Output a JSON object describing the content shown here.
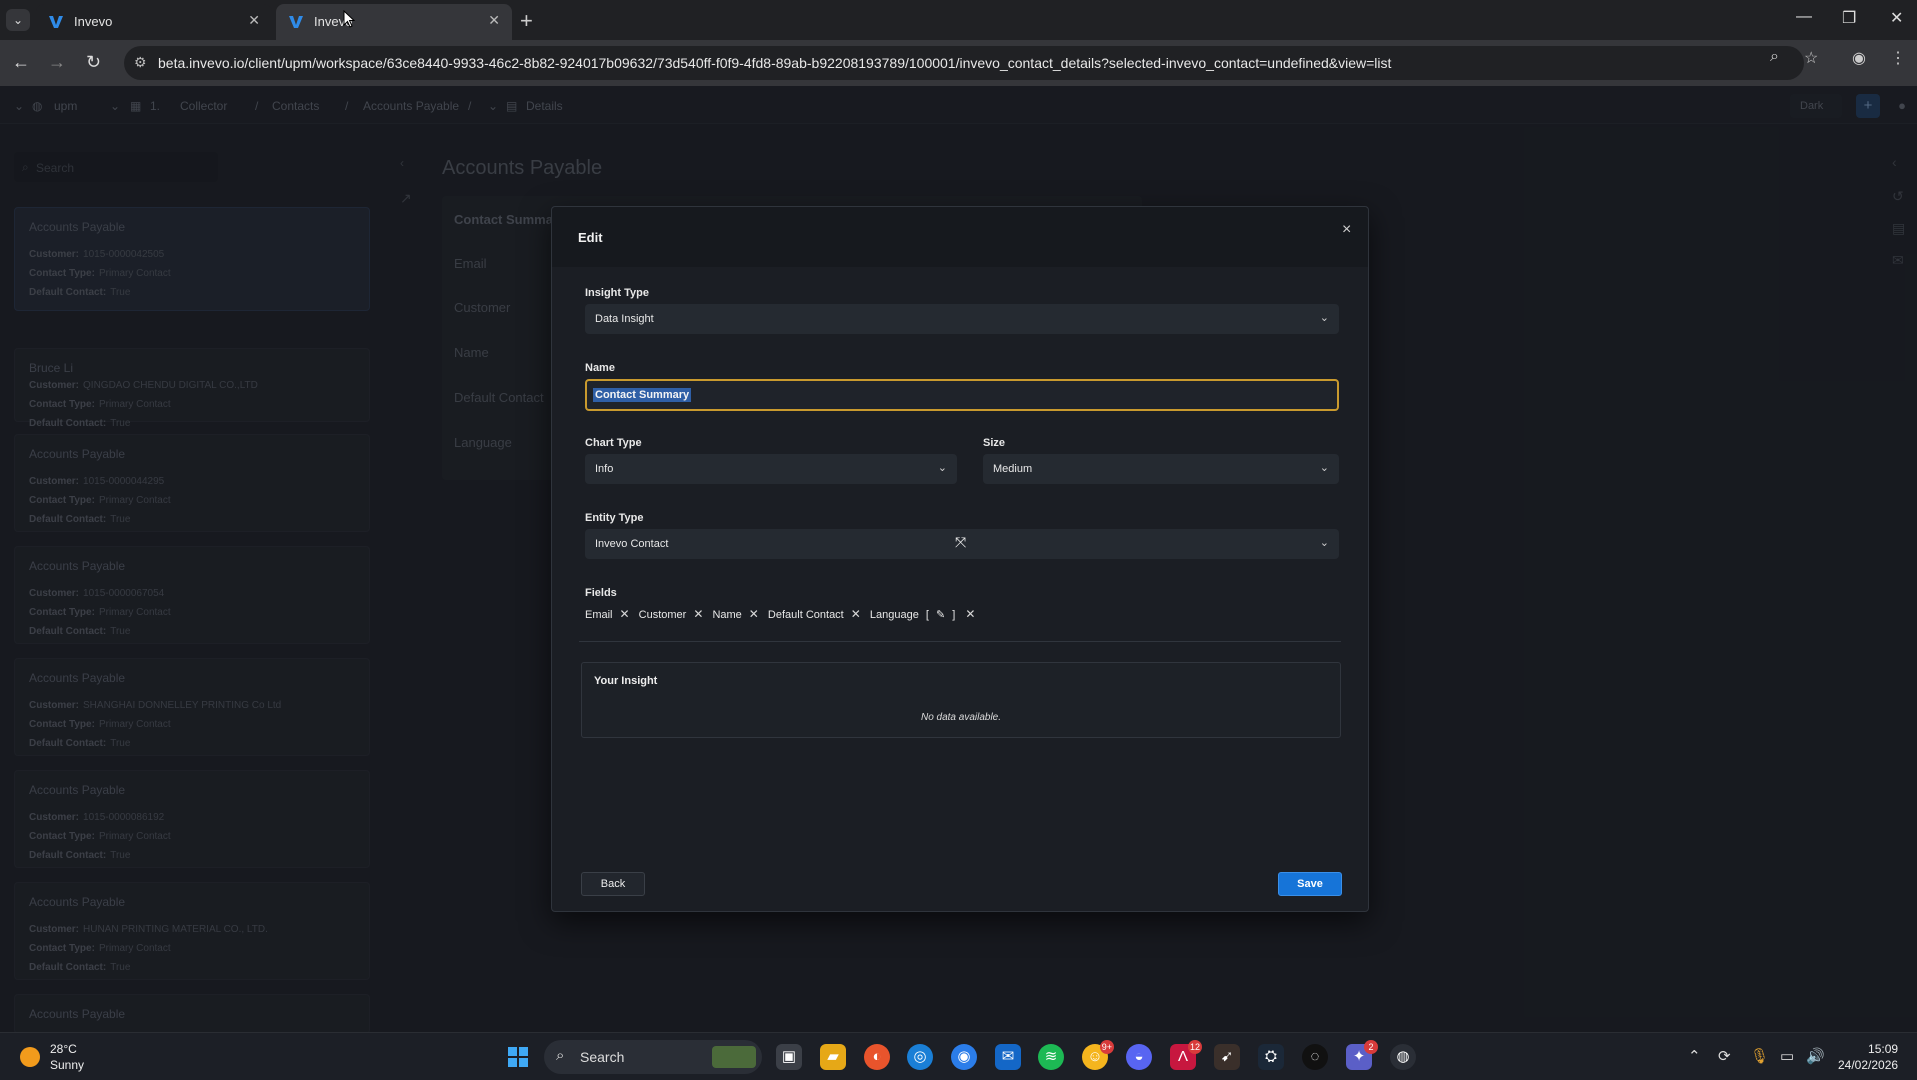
{
  "browser": {
    "tabs": [
      {
        "title": "Invevo",
        "active": false
      },
      {
        "title": "Invevo",
        "active": true
      }
    ],
    "new_tab": "+",
    "url": "beta.invevo.io/client/upm/workspace/63ce8440-9933-46c2-8b82-924017b09632/73d540ff-f0f9-4fd8-89ab-b92208193789/100001/invevo_contact_details?selected-invevo_contact=undefined&view=list"
  },
  "breadcrumbs": {
    "workspace": "upm",
    "item1": "1.",
    "collector": "Collector",
    "contacts": "Contacts",
    "accounts_payable": "Accounts Payable",
    "details": "Details",
    "theme": "Dark"
  },
  "sidebar": {
    "search_placeholder": "Search",
    "cards": [
      {
        "title": "Accounts Payable",
        "customer": "1015-0000042505",
        "contact_type": "Primary Contact",
        "default_contact": "True"
      },
      {
        "title": "Bruce Li",
        "customer": "QINGDAO CHENDU DIGITAL CO.,LTD",
        "contact_type": "Primary Contact",
        "default_contact": "True"
      },
      {
        "title": "Accounts Payable",
        "customer": "1015-0000044295",
        "contact_type": "Primary Contact",
        "default_contact": "True"
      },
      {
        "title": "Accounts Payable",
        "customer": "1015-0000067054",
        "contact_type": "Primary Contact",
        "default_contact": "True"
      },
      {
        "title": "Accounts Payable",
        "customer": "SHANGHAI DONNELLEY PRINTING Co Ltd",
        "contact_type": "Primary Contact",
        "default_contact": "True"
      },
      {
        "title": "Accounts Payable",
        "customer": "1015-0000086192",
        "contact_type": "Primary Contact",
        "default_contact": "True"
      },
      {
        "title": "Accounts Payable",
        "customer": "HUNAN PRINTING MATERIAL CO., LTD.",
        "contact_type": "Primary Contact",
        "default_contact": "True"
      },
      {
        "title": "Accounts Payable"
      }
    ],
    "labels": {
      "customer": "Customer:",
      "contact_type": "Contact Type:",
      "default_contact": "Default Contact:"
    }
  },
  "main": {
    "title": "Accounts Payable",
    "summary": {
      "heading": "Contact Summar",
      "fields": [
        "Email",
        "Customer",
        "Name",
        "Default Contact",
        "Language"
      ]
    }
  },
  "modal": {
    "title": "Edit",
    "close": "×",
    "insight_type_label": "Insight Type",
    "insight_type_value": "Data Insight",
    "name_label": "Name",
    "name_value": "Contact Summary",
    "chart_type_label": "Chart Type",
    "chart_type_value": "Info",
    "size_label": "Size",
    "size_value": "Medium",
    "entity_type_label": "Entity Type",
    "entity_type_value": "Invevo Contact",
    "fields_label": "Fields",
    "fields": [
      {
        "label": "Email"
      },
      {
        "label": "Customer"
      },
      {
        "label": "Name"
      },
      {
        "label": "Default Contact"
      },
      {
        "label": "Language"
      }
    ],
    "language_bracket_open": "[",
    "language_bracket_close": "]",
    "your_insight": "Your Insight",
    "no_data": "No data available.",
    "back": "Back",
    "save": "Save"
  },
  "taskbar": {
    "temperature": "28°C",
    "weather": "Sunny",
    "search": "Search",
    "time": "15:09",
    "date": "24/02/2026",
    "badge_9": "9+",
    "badge_12": "12",
    "badge_2": "2"
  },
  "colors": {
    "accent": "#1674d8",
    "focus": "#c99a2e",
    "selection": "#2f5fa6"
  }
}
